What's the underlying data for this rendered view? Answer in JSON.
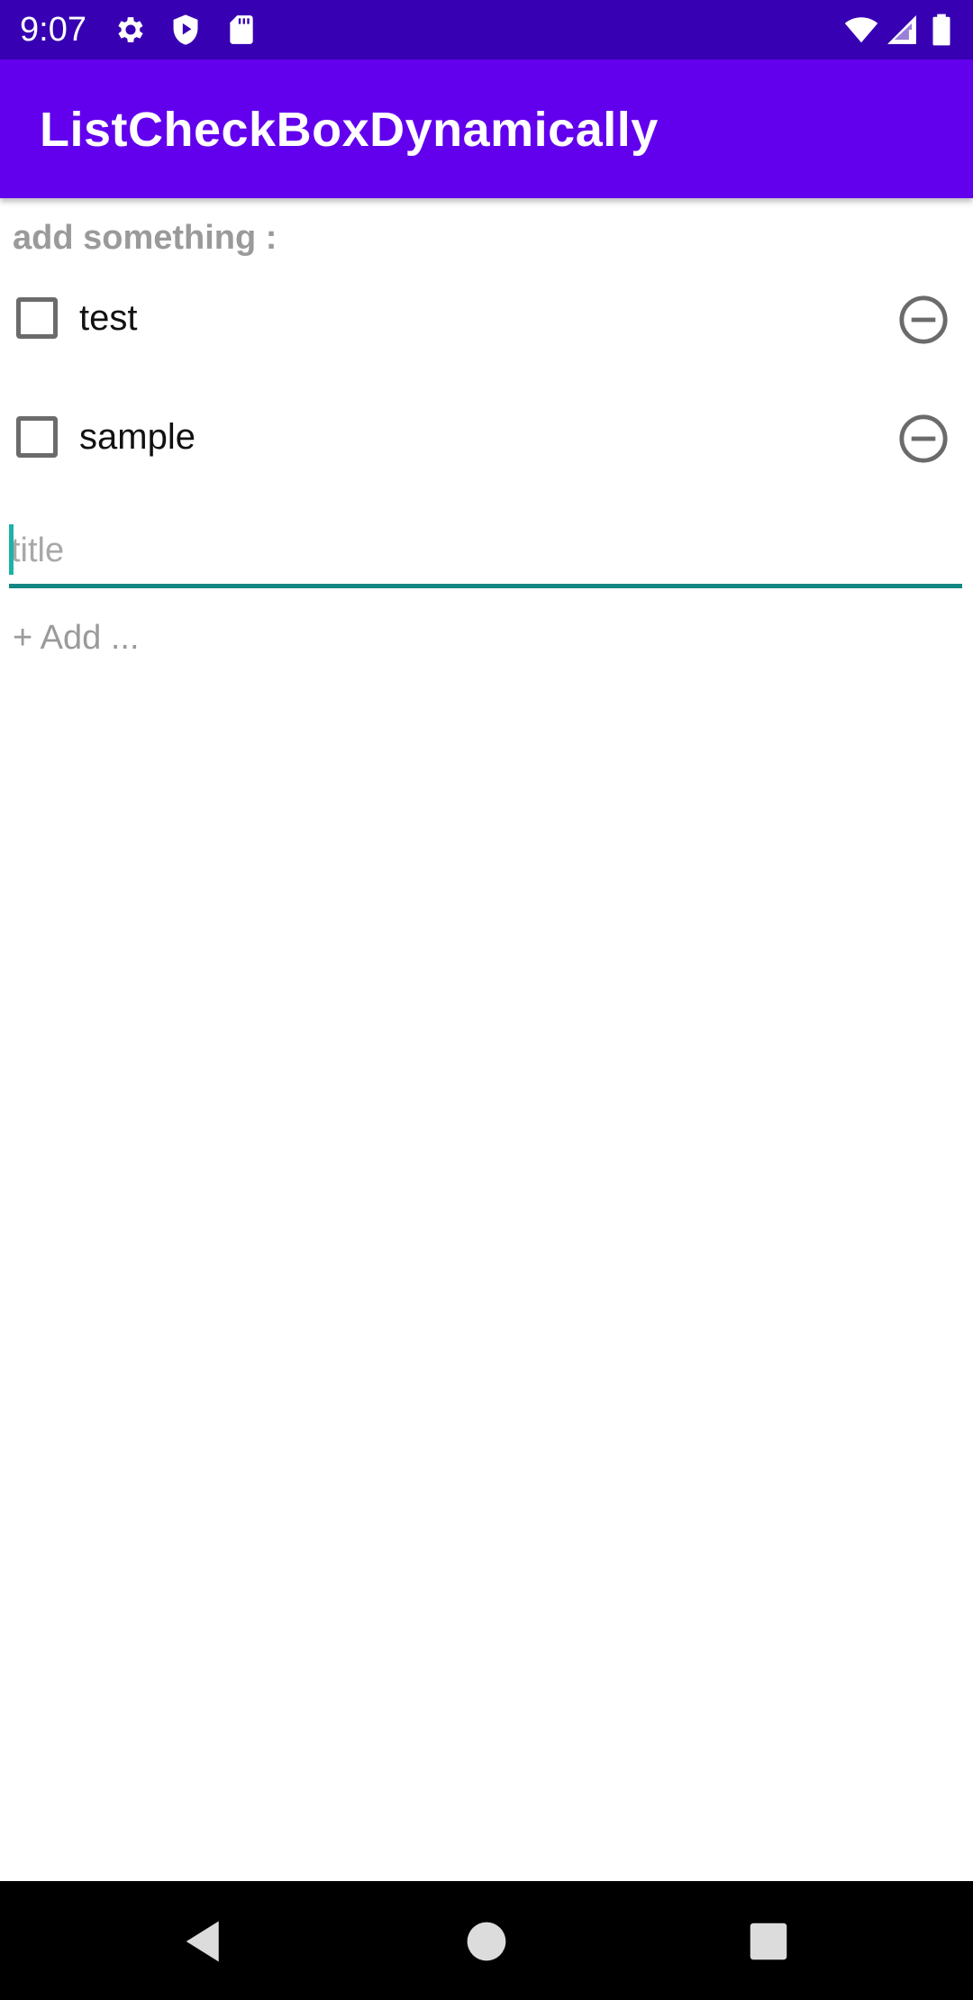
{
  "status_bar": {
    "time": "9:07",
    "icons_left": [
      "gear-icon",
      "shield-play-icon",
      "sd-card-icon"
    ],
    "icons_right": [
      "wifi-icon",
      "cell-signal-icon",
      "battery-icon"
    ],
    "background": "#3700B3"
  },
  "app_bar": {
    "title": "ListCheckBoxDynamically",
    "background": "#6200EE"
  },
  "content": {
    "section_label": "add something :",
    "items": [
      {
        "label": "test",
        "checked": false
      },
      {
        "label": "sample",
        "checked": false
      }
    ],
    "title_input": {
      "value": "",
      "placeholder": "title",
      "underline_color": "#148684"
    },
    "add_label": "+ Add ..."
  },
  "nav_bar": {
    "buttons": [
      "back-icon",
      "home-icon",
      "recents-icon"
    ]
  }
}
